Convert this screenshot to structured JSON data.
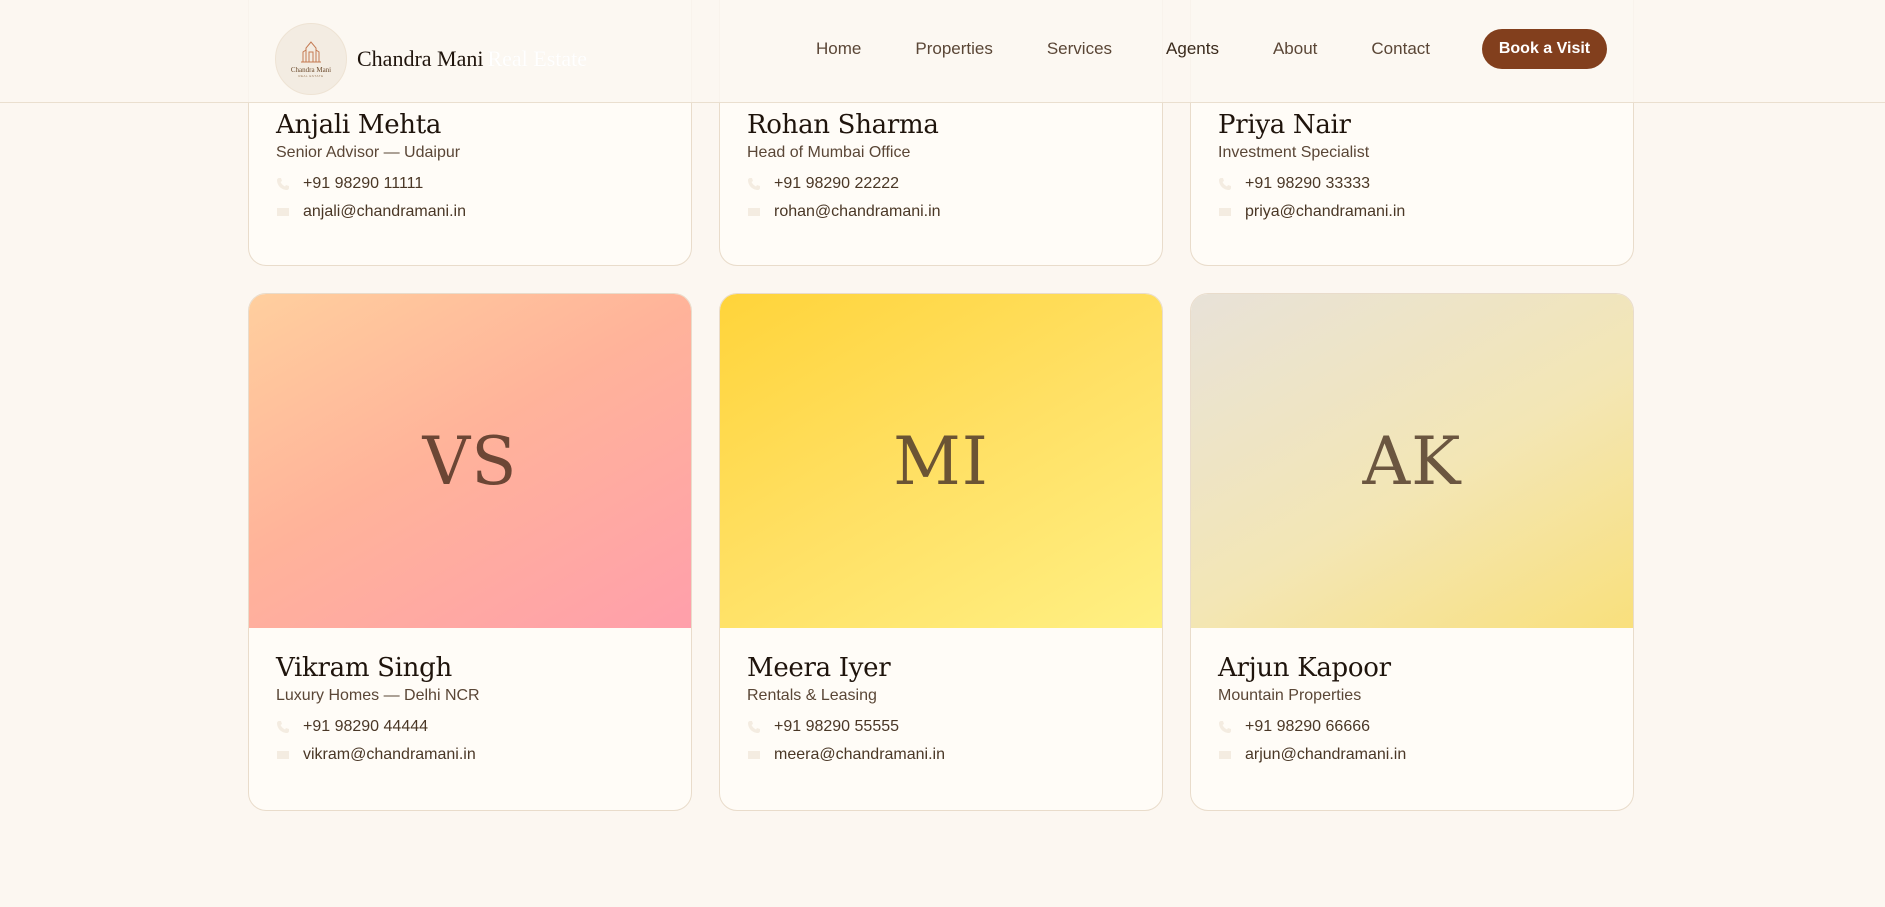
{
  "brand": {
    "logo_text": "Chandra Mani",
    "logo_subtext": "REAL ESTATE",
    "name_primary": "Chandra Mani",
    "name_secondary": "Real Estate"
  },
  "nav": {
    "items": [
      {
        "label": "Home"
      },
      {
        "label": "Properties"
      },
      {
        "label": "Services"
      },
      {
        "label": "Agents"
      },
      {
        "label": "About"
      },
      {
        "label": "Contact"
      }
    ],
    "cta_label": "Book a Visit"
  },
  "agents": [
    {
      "name": "Anjali Mehta",
      "role": "Senior Advisor — Udaipur",
      "phone": "+91 98290 11111",
      "email": "anjali@chandramani.in"
    },
    {
      "name": "Rohan Sharma",
      "role": "Head of Mumbai Office",
      "phone": "+91 98290 22222",
      "email": "rohan@chandramani.in"
    },
    {
      "name": "Priya Nair",
      "role": "Investment Specialist",
      "phone": "+91 98290 33333",
      "email": "priya@chandramani.in"
    },
    {
      "initials": "VS",
      "name": "Vikram Singh",
      "role": "Luxury Homes — Delhi NCR",
      "phone": "+91 98290 44444",
      "email": "vikram@chandramani.in"
    },
    {
      "initials": "MI",
      "name": "Meera Iyer",
      "role": "Rentals & Leasing",
      "phone": "+91 98290 55555",
      "email": "meera@chandramani.in"
    },
    {
      "initials": "AK",
      "name": "Arjun Kapoor",
      "role": "Mountain Properties",
      "phone": "+91 98290 66666",
      "email": "arjun@chandramani.in"
    }
  ],
  "icons": {
    "logo": "building-icon",
    "phone": "phone-icon",
    "email": "mail-icon"
  },
  "colors": {
    "accent": "#823f1d",
    "background": "#fcf7f1",
    "card": "#fffcf7"
  }
}
